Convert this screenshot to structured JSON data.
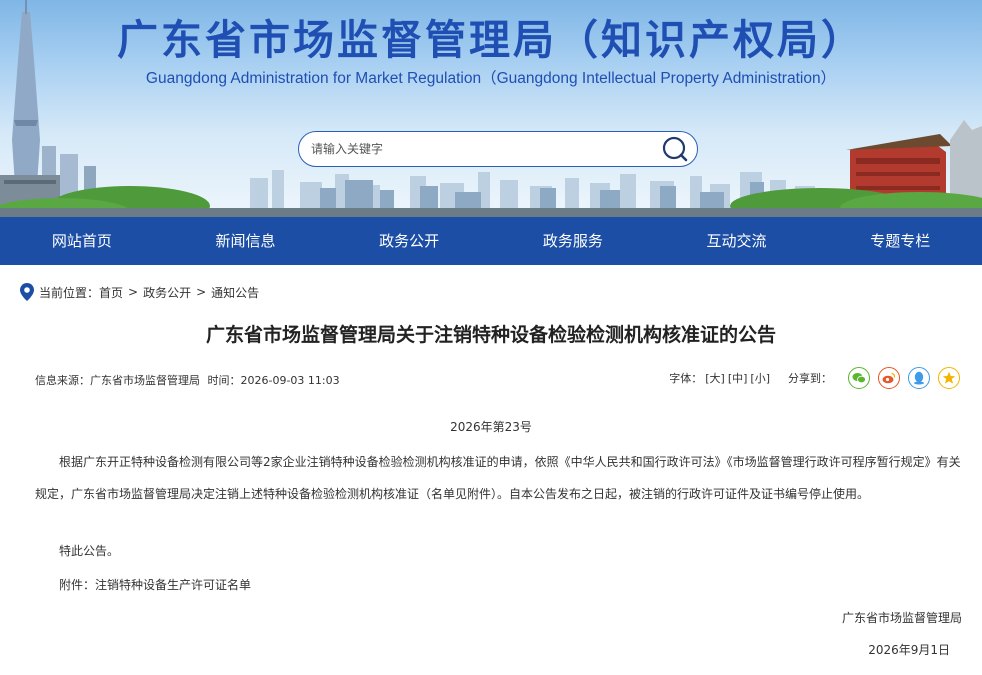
{
  "header": {
    "title": "广东省市场监督管理局（知识产权局）",
    "subtitle": "Guangdong Administration for Market Regulation（Guangdong Intellectual Property Administration）",
    "search_placeholder": "请输入关键字"
  },
  "nav": {
    "items": [
      "网站首页",
      "新闻信息",
      "政务公开",
      "政务服务",
      "互动交流",
      "专题专栏"
    ]
  },
  "breadcrumb": {
    "label": "当前位置：",
    "items": [
      "首页",
      "政务公开",
      "通知公告"
    ],
    "separator": ">"
  },
  "article": {
    "title": "广东省市场监督管理局关于注销特种设备检验检测机构核准证的公告",
    "source": "信息来源：广东省市场监督管理局",
    "time": "时间：2026-09-03 11:03",
    "font_size_label": "字体：",
    "font_sizes": [
      "[大]",
      "[中]",
      "[小]"
    ],
    "share_label": "分享到：",
    "share_icons": [
      "wechat-icon",
      "weibo-icon",
      "qq-icon",
      "qzone-icon"
    ],
    "doc_number": "2026年第23号",
    "paragraph1": "根据广东开正特种设备检测有限公司等2家企业注销特种设备检验检测机构核准证的申请，依照《中华人民共和国行政许可法》《市场监督管理行政许可程序暂行规定》有关规定，广东省市场监督管理局决定注销上述特种设备检验检测机构核准证（名单见附件）。自本公告发布之日起，被注销的行政许可证件及证书编号停止使用。",
    "paragraph2": "特此公告。",
    "attachment": "附件：注销特种设备生产许可证名单",
    "signature": "广东省市场监督管理局",
    "date": "2026年9月1日"
  },
  "colors": {
    "brand_blue": "#1c4ea6",
    "title_blue": "#1f4fb3",
    "wechat_green": "#5cb531",
    "weibo_red": "#e6572c",
    "qq_blue": "#3d9be9",
    "qzone_yellow": "#f4b400"
  }
}
